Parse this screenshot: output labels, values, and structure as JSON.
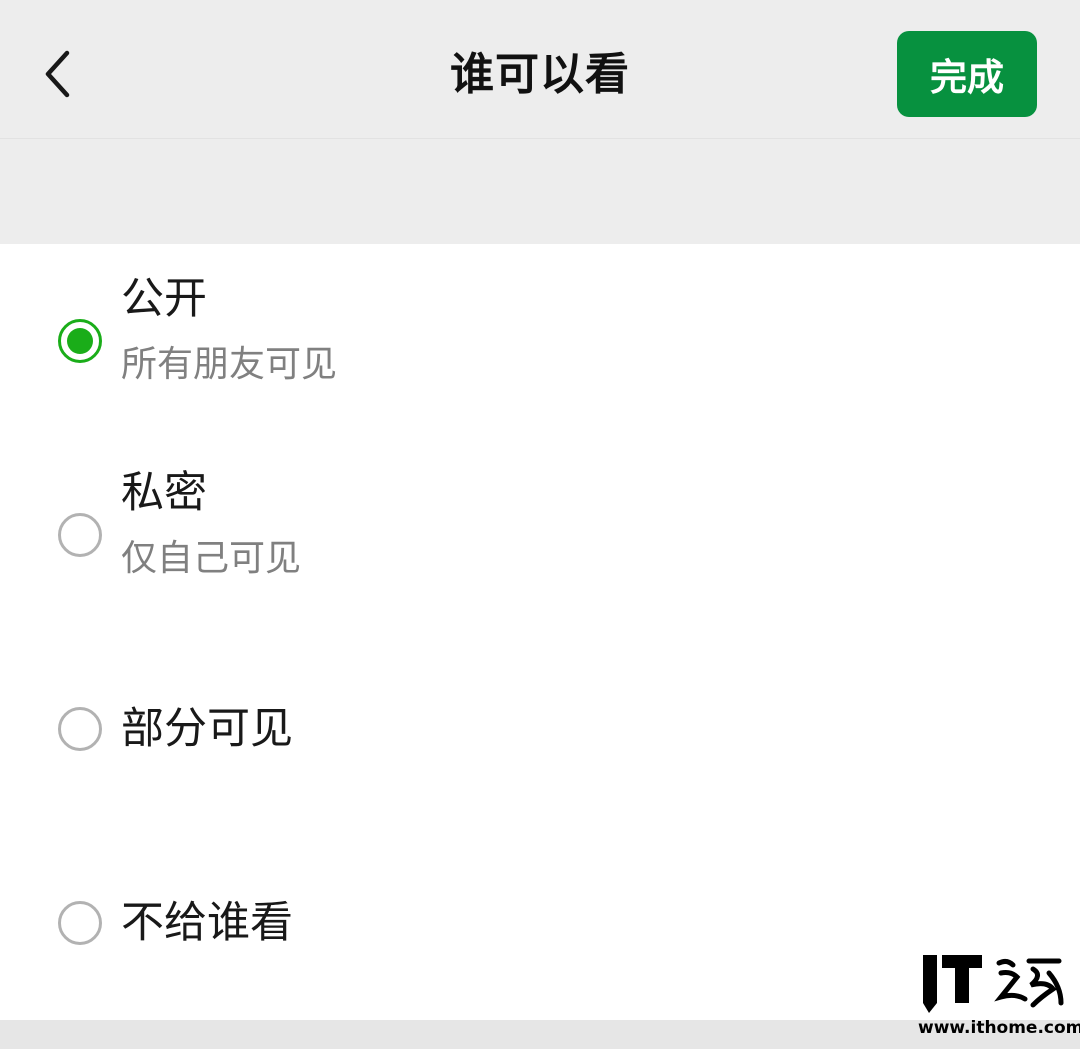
{
  "colors": {
    "accent": "#07913f",
    "radio_checked": "#1aad19",
    "radio_unchecked": "#b2b2b2",
    "background": "#ededed"
  },
  "header": {
    "back_icon": "chevron-left-icon",
    "title": "谁可以看",
    "done_label": "完成"
  },
  "options": [
    {
      "label": "公开",
      "description": "所有朋友可见",
      "checked": true
    },
    {
      "label": "私密",
      "description": "仅自己可见",
      "checked": false
    },
    {
      "label": "部分可见",
      "checked": false
    },
    {
      "label": "不给谁看",
      "checked": false
    }
  ],
  "watermark": {
    "brand": "IT之家",
    "url": "www.ithome.com"
  }
}
